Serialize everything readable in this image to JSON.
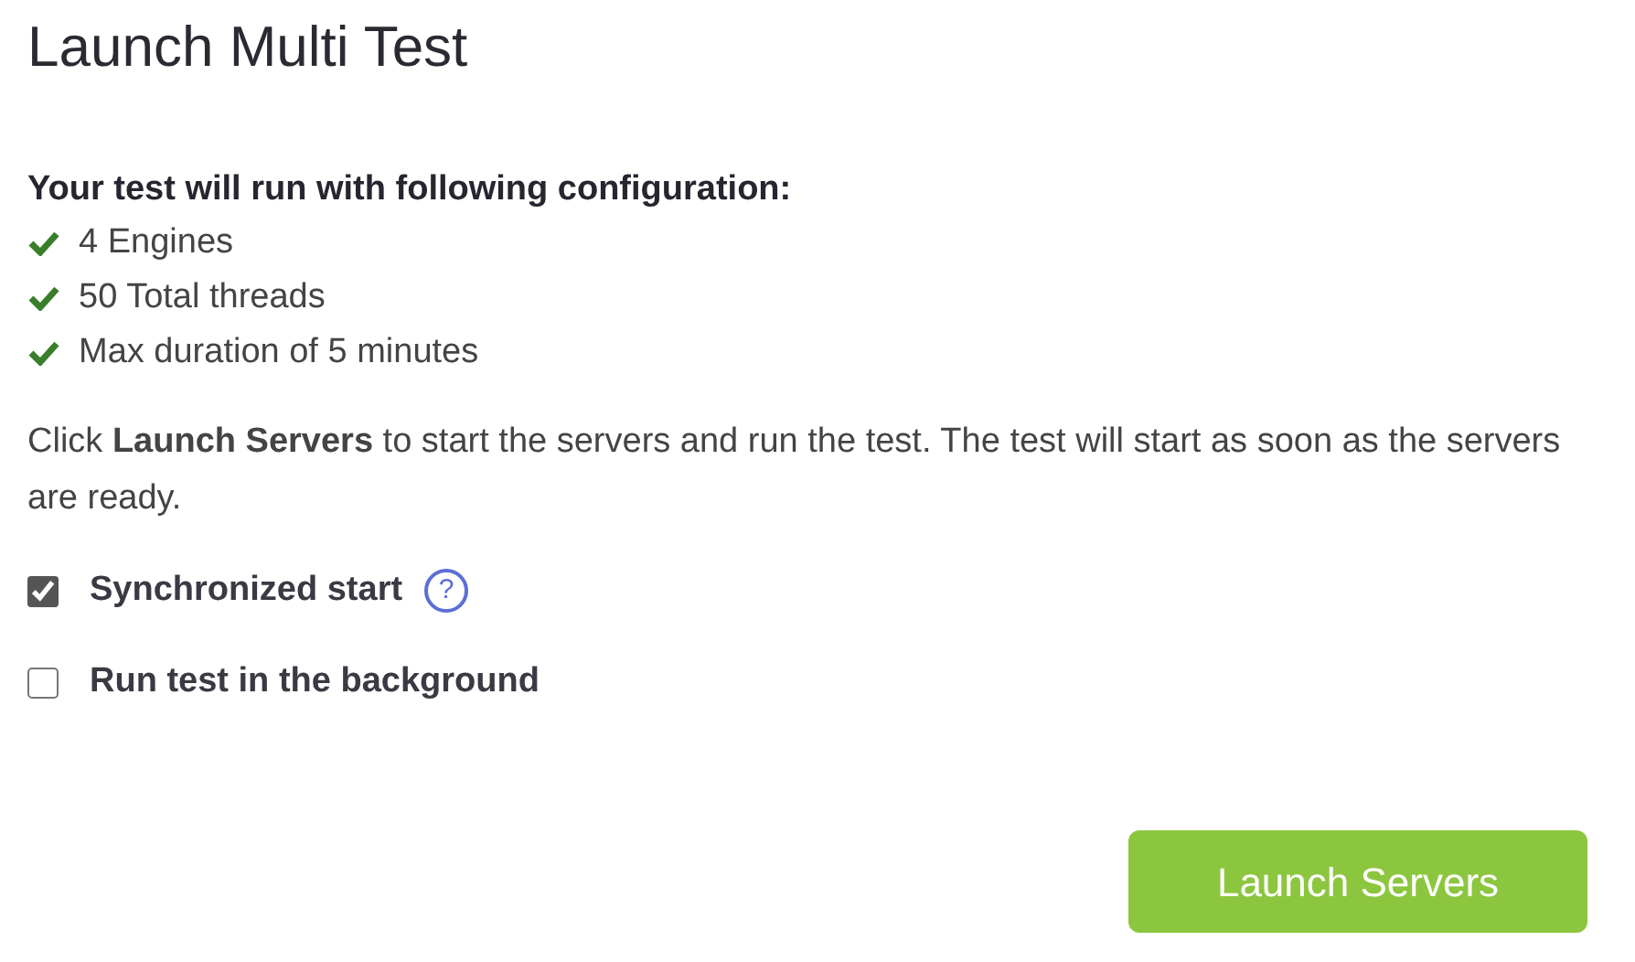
{
  "title": "Launch Multi Test",
  "configuration": {
    "heading": "Your test will run with following configuration:",
    "items": [
      {
        "text": "4 Engines",
        "checked": true
      },
      {
        "text": "50 Total threads",
        "checked": true
      },
      {
        "text": "Max duration of 5 minutes",
        "checked": true
      }
    ]
  },
  "description": "Click **Launch Servers** to start the servers and run the test. The test will start as soon as the servers are ready.",
  "options": [
    {
      "label": "Synchronized start",
      "checked": true,
      "help": "?"
    },
    {
      "label": "Run test in the background",
      "checked": false
    }
  ],
  "button": "Launch Servers"
}
